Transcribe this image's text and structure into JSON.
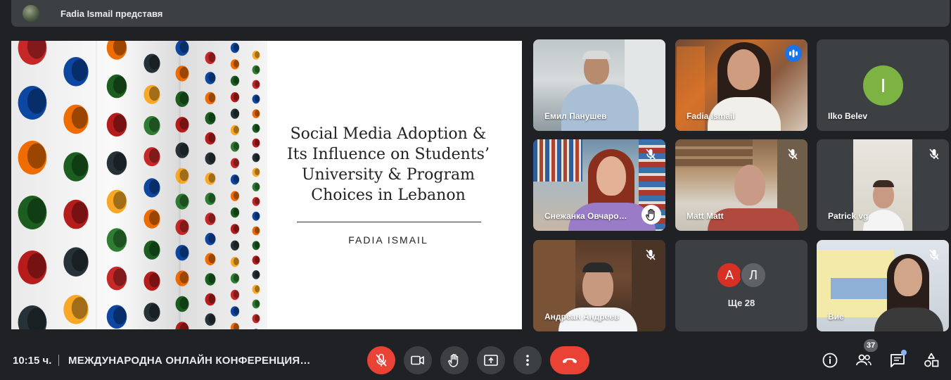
{
  "presenter_bar": {
    "text": "Fadia Ismail представя"
  },
  "slide": {
    "title": "Social Media Adoption & Its Influence on Students’ University & Program Choices in Lebanon",
    "author": "FADIA ISMAIL"
  },
  "participants": [
    {
      "name": "Емил Панушев",
      "muted": false
    },
    {
      "name": "Fadia Ismail",
      "speaking": true
    },
    {
      "name": "Ilko Belev",
      "avatar_initial": "I",
      "avatar_color": "#7cb342"
    },
    {
      "name": "Снежанка Овчаро…",
      "muted": true,
      "hand_raised": true
    },
    {
      "name": "Matt Matt",
      "muted": true
    },
    {
      "name": "Patrick vg",
      "muted": true
    },
    {
      "name": "Андреан Андреев",
      "muted": true
    },
    {
      "name": "Ще 28",
      "avatars": [
        {
          "initial": "А",
          "color": "#d93025"
        },
        {
          "initial": "Л",
          "color": "#5f6368"
        }
      ]
    },
    {
      "name": "Вие",
      "muted": true
    }
  ],
  "bottom_bar": {
    "time": "10:15 ч.",
    "meeting_title": "МЕЖДУНАРОДНА ОНЛАЙН КОНФЕРЕНЦИЯ…",
    "people_count": "37"
  },
  "colors": {
    "accent": "#8ab4f8",
    "danger": "#ea4335",
    "surface": "#3c4043",
    "background": "#202124"
  }
}
